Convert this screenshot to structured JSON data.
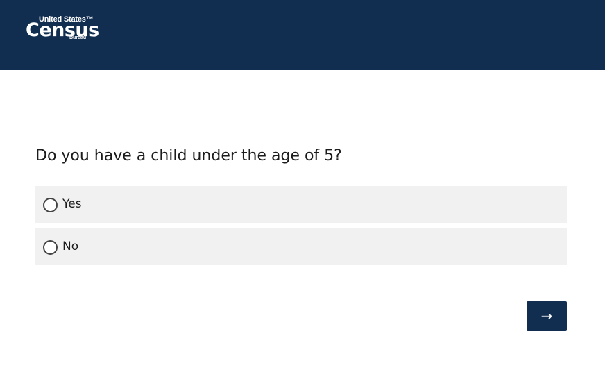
{
  "header": {
    "logo": {
      "line1": "United States™",
      "line2": "Census",
      "line3": "Bureau"
    },
    "background_color": "#112e51"
  },
  "question": {
    "text": "Do you have a child under the age of 5?",
    "options": [
      {
        "label": "Yes",
        "selected": false
      },
      {
        "label": "No",
        "selected": false
      }
    ]
  },
  "navigation": {
    "next_icon": "right-arrow-icon",
    "next_glyph": "→"
  }
}
